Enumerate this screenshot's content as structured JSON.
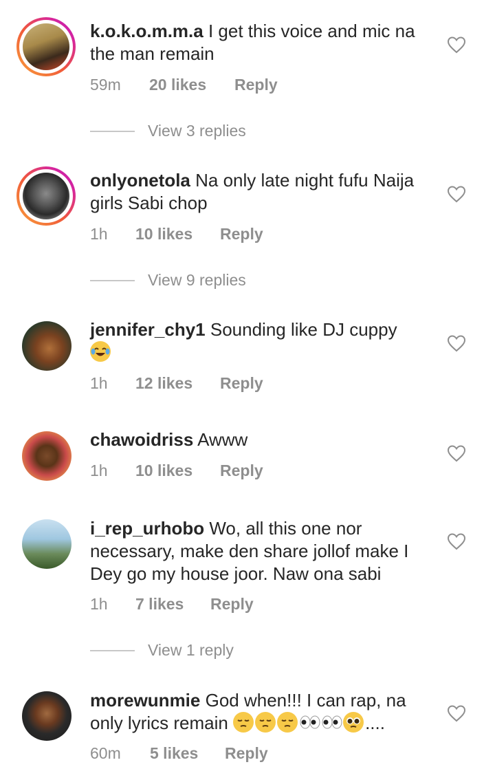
{
  "comments": [
    {
      "username": "k.o.k.o.m.m.a",
      "text": " I get this voice and mic na the  man remain",
      "time": "59m",
      "likes": "20 likes",
      "reply": "Reply",
      "view_replies": "View 3 replies"
    },
    {
      "username": "onlyonetola",
      "text": " Na only late night fufu Naija girls Sabi chop",
      "time": "1h",
      "likes": "10 likes",
      "reply": "Reply",
      "view_replies": "View 9 replies"
    },
    {
      "username": "jennifer_chy1",
      "text": " Sounding like DJ cuppy",
      "time": "1h",
      "likes": "12 likes",
      "reply": "Reply"
    },
    {
      "username": "chawoidriss",
      "text": " Awww",
      "time": "1h",
      "likes": "10 likes",
      "reply": "Reply"
    },
    {
      "username": "i_rep_urhobo",
      "text": " Wo, all this one nor necessary, make den share jollof make I Dey go my house joor. Naw ona sabi",
      "time": "1h",
      "likes": "7 likes",
      "reply": "Reply",
      "view_replies": "View 1 reply"
    },
    {
      "username": "morewunmie",
      "text": " God when!!! I can rap, na only lyrics remain ",
      "text_tail": "....",
      "time": "60m",
      "likes": "5 likes",
      "reply": "Reply"
    }
  ],
  "icons": {
    "like": "heart-outline-icon",
    "emoji_laugh": "face-with-tears-of-joy",
    "emoji_pensive": "pensive-face",
    "emoji_eyes": "eyes",
    "emoji_pleading": "pleading-face"
  },
  "colors": {
    "text": "#262626",
    "muted": "#8e8e8e",
    "story_ring_start": "#f9a13a",
    "story_ring_end": "#b01fb8"
  }
}
